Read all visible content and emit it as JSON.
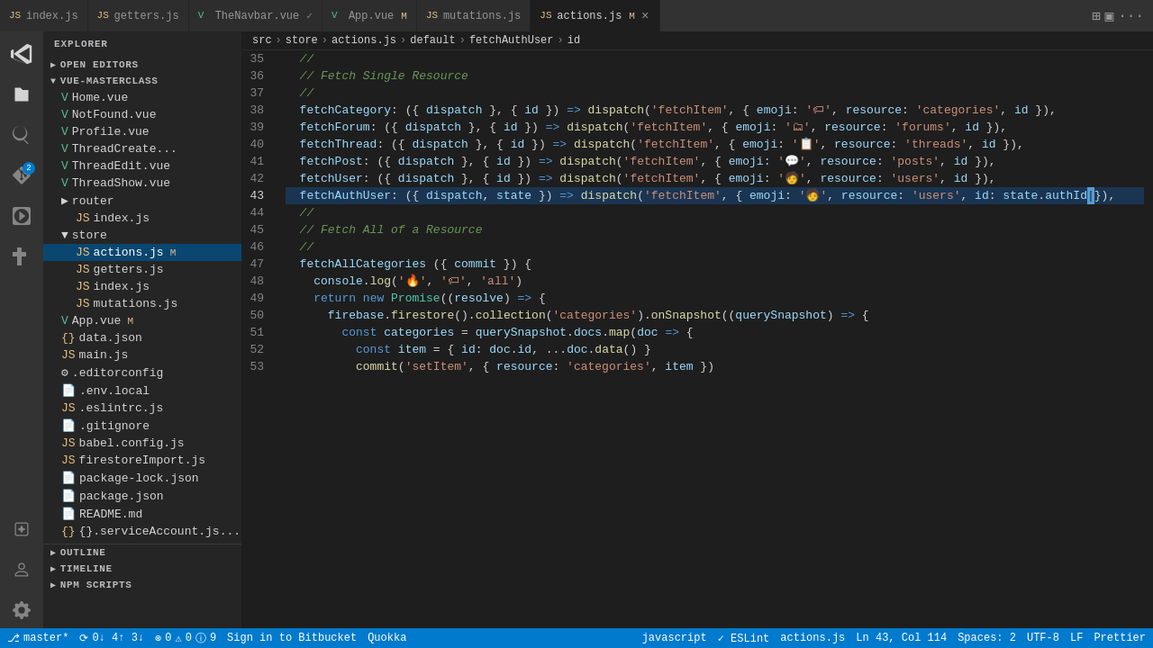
{
  "titlebar": {
    "tabs": [
      {
        "id": "index-js",
        "label": "index.js",
        "icon": "📄",
        "active": false,
        "modified": false,
        "color": "#e8c07d"
      },
      {
        "id": "getters-js",
        "label": "getters.js",
        "icon": "📄",
        "active": false,
        "modified": false,
        "color": "#e8c07d"
      },
      {
        "id": "thenavbar-vue",
        "label": "TheNavbar.vue",
        "icon": "V",
        "active": false,
        "modified": false,
        "color": "#4fc08d"
      },
      {
        "id": "app-vue",
        "label": "App.vue",
        "icon": "V",
        "active": false,
        "modified": true,
        "badge": "M",
        "color": "#4fc08d"
      },
      {
        "id": "mutations-js",
        "label": "mutations.js",
        "icon": "📄",
        "active": false,
        "modified": false,
        "color": "#e8c07d"
      },
      {
        "id": "actions-js",
        "label": "actions.js",
        "icon": "📄",
        "active": true,
        "modified": true,
        "badge": "M",
        "color": "#e8c07d",
        "closeable": true
      }
    ],
    "buttons": [
      "split",
      "layout",
      "more"
    ]
  },
  "sidebar": {
    "title": "EXPLORER",
    "sections": {
      "open_editors": "OPEN EDITORS",
      "project": "VUE-MASTERCLASS"
    },
    "tree": [
      {
        "indent": 0,
        "label": "Home.vue",
        "icon": "V",
        "type": "vue",
        "color": "#4fc08d"
      },
      {
        "indent": 0,
        "label": "NotFound.vue",
        "icon": "V",
        "type": "vue",
        "color": "#4fc08d"
      },
      {
        "indent": 0,
        "label": "Profile.vue",
        "icon": "V",
        "type": "vue",
        "color": "#4fc08d"
      },
      {
        "indent": 0,
        "label": "ThreadCreate...",
        "icon": "V",
        "type": "vue",
        "color": "#4fc08d"
      },
      {
        "indent": 0,
        "label": "ThreadEdit.vue",
        "icon": "V",
        "type": "vue",
        "color": "#4fc08d"
      },
      {
        "indent": 0,
        "label": "ThreadShow.vue",
        "icon": "V",
        "type": "vue",
        "color": "#4fc08d"
      },
      {
        "indent": 0,
        "label": "router",
        "icon": "📁",
        "type": "folder"
      },
      {
        "indent": 1,
        "label": "index.js",
        "icon": "📄",
        "type": "js"
      },
      {
        "indent": 0,
        "label": "store",
        "icon": "📁",
        "type": "folder",
        "open": true
      },
      {
        "indent": 1,
        "label": "actions.js",
        "icon": "📄",
        "type": "js",
        "modified": true,
        "active": true
      },
      {
        "indent": 1,
        "label": "getters.js",
        "icon": "📄",
        "type": "js"
      },
      {
        "indent": 1,
        "label": "index.js",
        "icon": "📄",
        "type": "js"
      },
      {
        "indent": 1,
        "label": "mutations.js",
        "icon": "📄",
        "type": "js"
      },
      {
        "indent": 0,
        "label": "App.vue",
        "icon": "V",
        "type": "vue",
        "modified": true,
        "color": "#4fc08d"
      },
      {
        "indent": 0,
        "label": "data.json",
        "icon": "{}",
        "type": "json"
      },
      {
        "indent": 0,
        "label": "main.js",
        "icon": "📄",
        "type": "js"
      },
      {
        "indent": 0,
        "label": ".editorconfig",
        "icon": "⚙",
        "type": "config"
      },
      {
        "indent": 0,
        "label": ".env.local",
        "icon": "📄",
        "type": "env"
      },
      {
        "indent": 0,
        "label": ".eslintrc.js",
        "icon": "📄",
        "type": "eslint"
      },
      {
        "indent": 0,
        "label": ".gitignore",
        "icon": "📄",
        "type": "git"
      },
      {
        "indent": 0,
        "label": "babel.config.js",
        "icon": "📄",
        "type": "babel"
      },
      {
        "indent": 0,
        "label": "firestoreImport.js",
        "icon": "📄",
        "type": "js"
      },
      {
        "indent": 0,
        "label": "package-lock.json",
        "icon": "📄",
        "type": "json"
      },
      {
        "indent": 0,
        "label": "package.json",
        "icon": "📄",
        "type": "json"
      },
      {
        "indent": 0,
        "label": "README.md",
        "icon": "📄",
        "type": "md"
      },
      {
        "indent": 0,
        "label": "{}.serviceAccount.js...",
        "icon": "{}",
        "type": "json"
      }
    ],
    "bottom": [
      "OUTLINE",
      "TIMELINE",
      "NPM SCRIPTS"
    ]
  },
  "breadcrumb": {
    "items": [
      "src",
      "store",
      "actions.js",
      "default",
      "fetchAuthUser",
      "id"
    ]
  },
  "code": {
    "lines": [
      {
        "num": 35,
        "content": "  //"
      },
      {
        "num": 36,
        "content": "  // Fetch Single Resource"
      },
      {
        "num": 37,
        "content": "  //"
      },
      {
        "num": 38,
        "content": "  fetchCategory: ({ dispatch }, { id }) => dispatch('fetchItem', { emoji: '🏷', resource: 'categories', id }),"
      },
      {
        "num": 39,
        "content": "  fetchForum: ({ dispatch }, { id }) => dispatch('fetchItem', { emoji: '🗂', resource: 'forums', id }),"
      },
      {
        "num": 40,
        "content": "  fetchThread: ({ dispatch }, { id }) => dispatch('fetchItem', { emoji: '📋', resource: 'threads', id }),"
      },
      {
        "num": 41,
        "content": "  fetchPost: ({ dispatch }, { id }) => dispatch('fetchItem', { emoji: '💬', resource: 'posts', id }),"
      },
      {
        "num": 42,
        "content": "  fetchUser: ({ dispatch }, { id }) => dispatch('fetchItem', { emoji: '🧑', resource: 'users', id }),"
      },
      {
        "num": 43,
        "content": "  fetchAuthUser: ({ dispatch, state }) => dispatch('fetchItem', { emoji: '🧑', resource: 'users', id: state.authId }),",
        "current": true
      },
      {
        "num": 44,
        "content": "  //"
      },
      {
        "num": 45,
        "content": "  // Fetch All of a Resource"
      },
      {
        "num": 46,
        "content": "  //"
      },
      {
        "num": 47,
        "content": "  fetchAllCategories ({ commit }) {"
      },
      {
        "num": 48,
        "content": "    console.log('🔥', '🏷', 'all')"
      },
      {
        "num": 49,
        "content": "    return new Promise((resolve) => {"
      },
      {
        "num": 50,
        "content": "      firebase.firestore().collection('categories').onSnapshot((querySnapshot) => {"
      },
      {
        "num": 51,
        "content": "        const categories = querySnapshot.docs.map(doc => {"
      },
      {
        "num": 52,
        "content": "          const item = { id: doc.id, ...doc.data() }"
      },
      {
        "num": 53,
        "content": "          commit('setItem', { resource: 'categories', item })"
      }
    ]
  },
  "statusbar": {
    "branch": "master*",
    "sync": "⟳ 0↓ 4↑ 3↓",
    "errors": "⊗ 0",
    "warnings": "⚠ 0",
    "info": "ⓘ 9",
    "quokka": "Quokka",
    "right": {
      "position": "Ln 43, Col 114",
      "spaces": "Spaces: 2",
      "encoding": "UTF-8",
      "lf": "LF",
      "language": "JavaScript",
      "eslint": "✓ ESLint",
      "prettier": "Prettier"
    }
  }
}
